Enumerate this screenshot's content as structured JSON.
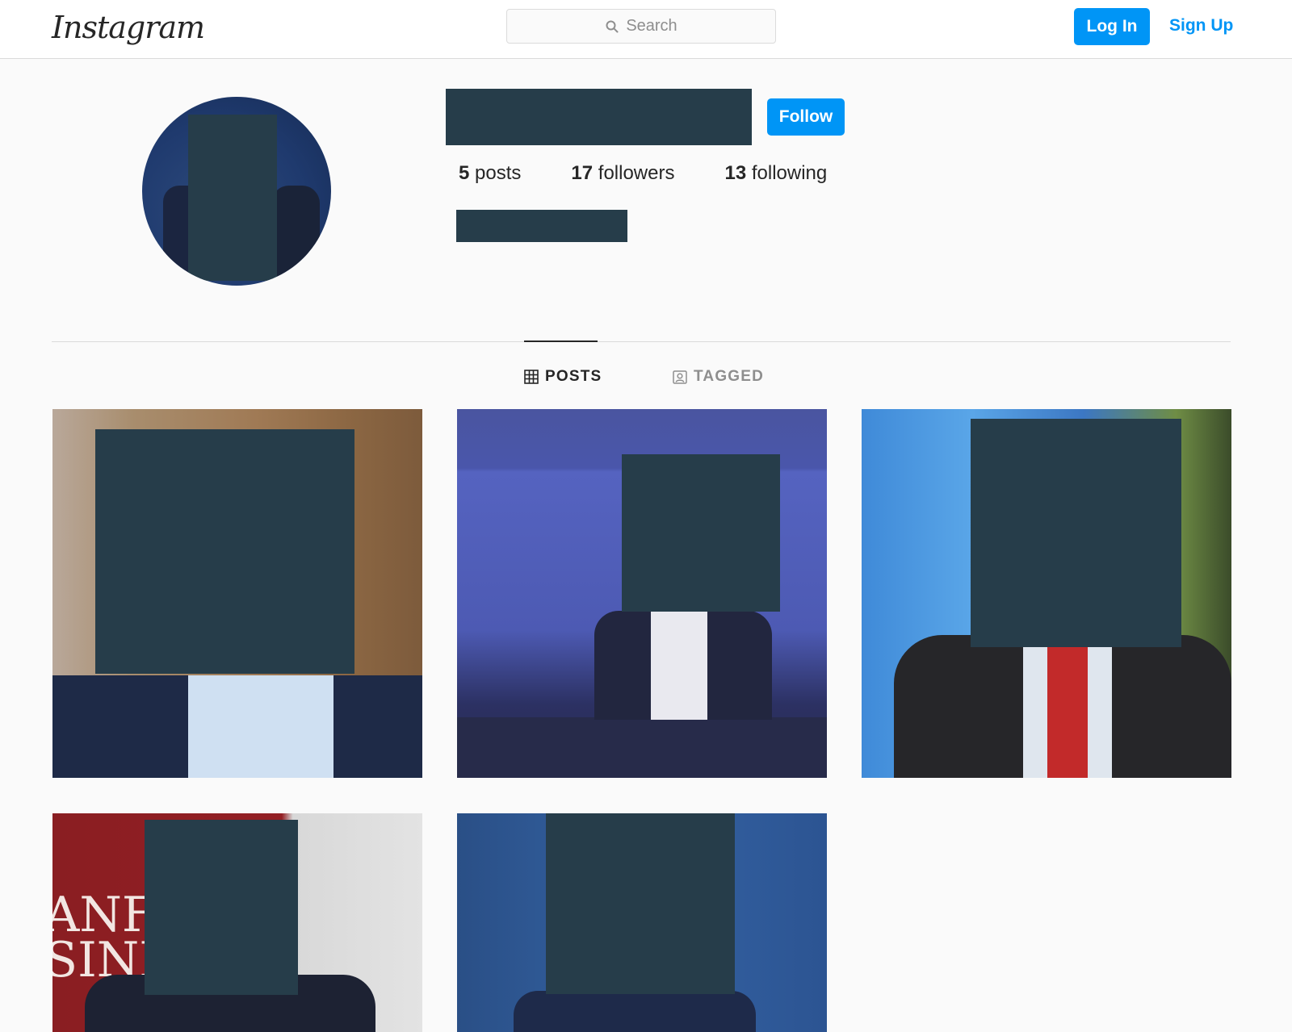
{
  "nav": {
    "logo_text": "Instagram",
    "search_placeholder": "Search",
    "login_label": "Log In",
    "signup_label": "Sign Up"
  },
  "profile": {
    "follow_label": "Follow",
    "stats": [
      {
        "count": "5",
        "label": "posts"
      },
      {
        "count": "17",
        "label": "followers"
      },
      {
        "count": "13",
        "label": "following"
      }
    ]
  },
  "tabs": [
    {
      "label": "POSTS",
      "icon": "grid-icon",
      "active": true
    },
    {
      "label": "TAGGED",
      "icon": "tagged-icon",
      "active": false
    }
  ],
  "posts_grid": {
    "sign_text": "ANFO\nSINE"
  },
  "colors": {
    "brand_blue": "#0095f6",
    "redaction": "#263d4a",
    "page_bg": "#fafafa"
  }
}
